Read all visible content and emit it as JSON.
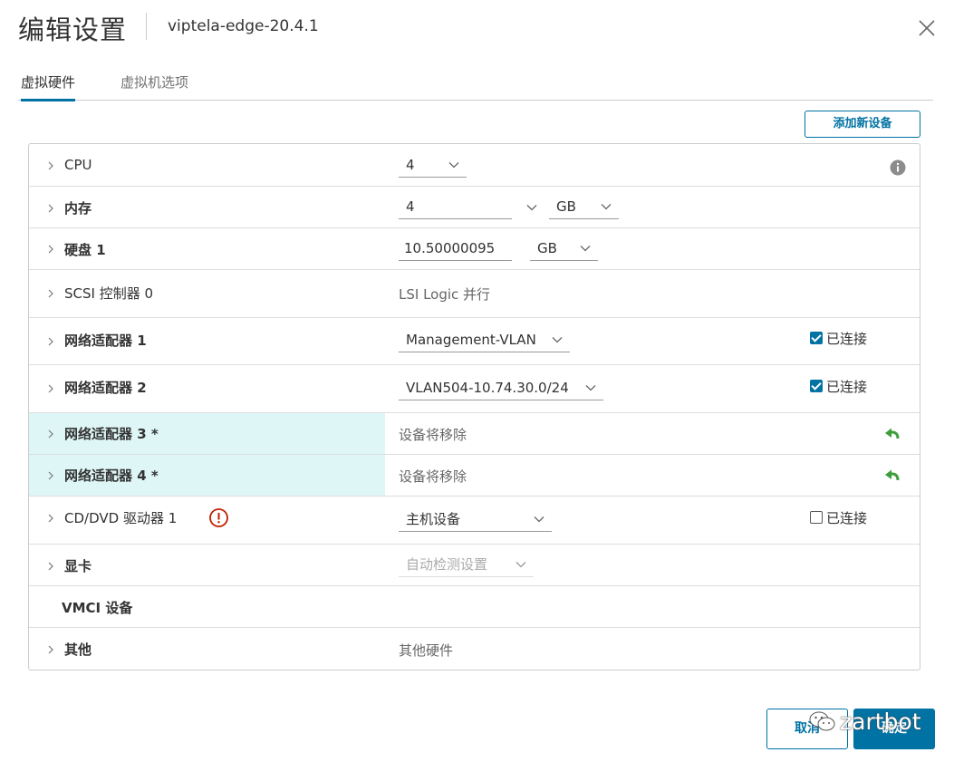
{
  "dialog": {
    "title": "编辑设置",
    "vm_name": "viptela-edge-20.4.1"
  },
  "tabs": [
    {
      "label": "虚拟硬件",
      "active": true
    },
    {
      "label": "虚拟机选项",
      "active": false
    }
  ],
  "add_device_label": "添加新设备",
  "rows": {
    "cpu": {
      "label": "CPU",
      "value": "4"
    },
    "memory": {
      "label": "内存",
      "value": "4",
      "unit": "GB"
    },
    "disk": {
      "label": "硬盘 1",
      "value": "10.50000095",
      "unit": "GB"
    },
    "scsi": {
      "label": "SCSI 控制器 0",
      "value": "LSI Logic 并行"
    },
    "nic1": {
      "label": "网络适配器 1",
      "value": "Management-VLAN",
      "connected_label": "已连接",
      "connected": true
    },
    "nic2": {
      "label": "网络适配器 2",
      "value": "VLAN504-10.74.30.0/24",
      "connected_label": "已连接",
      "connected": true
    },
    "nic3": {
      "label": "网络适配器 3 *",
      "value": "设备将移除"
    },
    "nic4": {
      "label": "网络适配器 4 *",
      "value": "设备将移除"
    },
    "cdrom": {
      "label": "CD/DVD 驱动器 1",
      "value": "主机设备",
      "connected_label": "已连接",
      "connected": false
    },
    "video": {
      "label": "显卡",
      "value": "自动检测设置"
    },
    "vmci": {
      "label": "VMCI 设备"
    },
    "other": {
      "label": "其他",
      "value": "其他硬件"
    }
  },
  "footer": {
    "cancel_label": "取消",
    "ok_label": "确定"
  },
  "watermark": "zartbot",
  "colors": {
    "accent": "#0072a3",
    "removed_row": "#dff6f7",
    "undo_green": "#3c9e3a",
    "warning_red": "#c21d00"
  }
}
